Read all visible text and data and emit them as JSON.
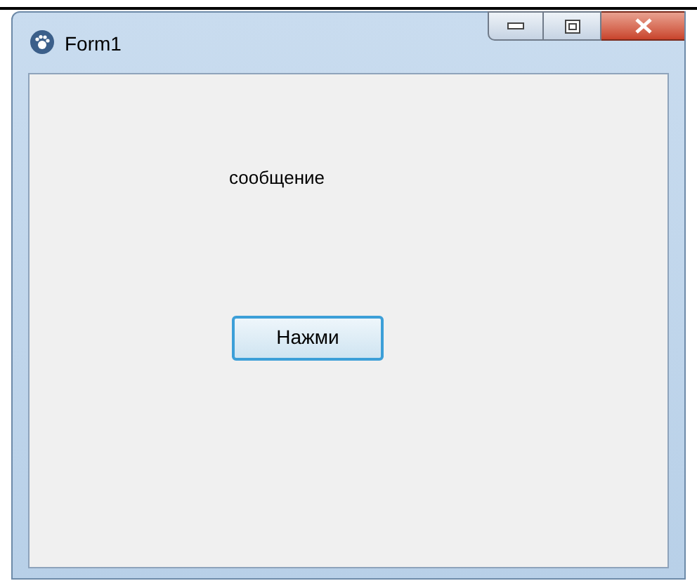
{
  "window": {
    "title": "Form1"
  },
  "label": "сообщение",
  "button": "Нажми"
}
